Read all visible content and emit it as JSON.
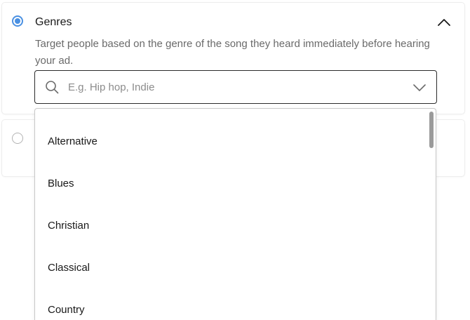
{
  "genres_section": {
    "title": "Genres",
    "description": "Target people based on the genre of the song they heard immediately before hearing your ad.",
    "search": {
      "placeholder": "E.g. Hip hop, Indie",
      "value": ""
    },
    "dropdown": {
      "options": [
        "Alternative",
        "Blues",
        "Christian",
        "Classical",
        "Country"
      ]
    }
  },
  "second_section": {},
  "colors": {
    "accent": "#4a90e2",
    "text": "#181818",
    "muted_text": "#6a6a6a",
    "border": "#2b2b2b"
  },
  "icons": {
    "radio_selected": "radio-selected-icon",
    "radio_unselected": "radio-unselected-icon",
    "collapse": "chevron-up-icon",
    "search": "search-icon",
    "expand": "chevron-down-icon"
  }
}
